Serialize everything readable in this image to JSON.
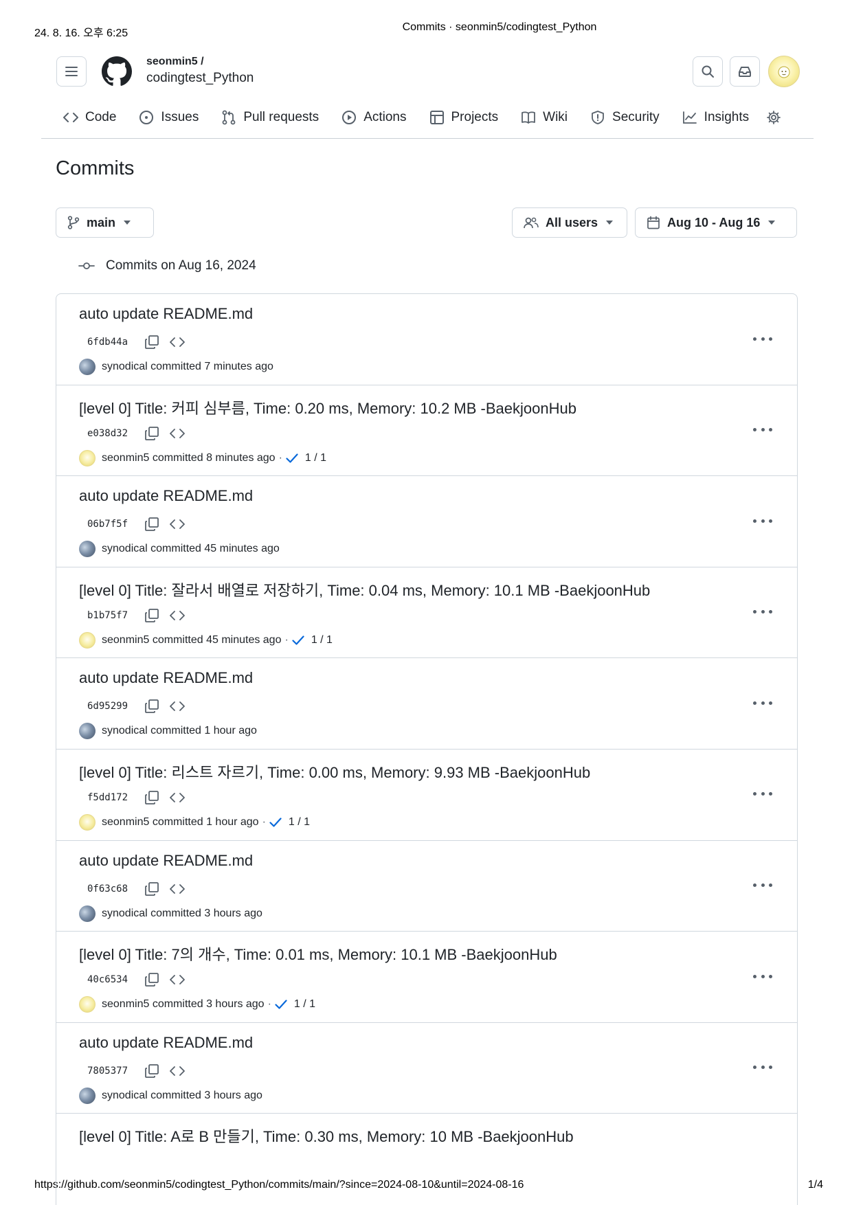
{
  "print": {
    "date": "24. 8. 16. 오후 6:25",
    "doc_title": "Commits · seonmin5/codingtest_Python",
    "url": "https://github.com/seonmin5/codingtest_Python/commits/main/?since=2024-08-10&until=2024-08-16",
    "page": "1/4"
  },
  "header": {
    "owner": "seonmin5 /",
    "repo": "codingtest_Python"
  },
  "tabs": [
    {
      "label": "Code",
      "icon": "code-icon"
    },
    {
      "label": "Issues",
      "icon": "issue-icon"
    },
    {
      "label": "Pull requests",
      "icon": "pull-request-icon"
    },
    {
      "label": "Actions",
      "icon": "play-icon"
    },
    {
      "label": "Projects",
      "icon": "table-icon"
    },
    {
      "label": "Wiki",
      "icon": "book-icon"
    },
    {
      "label": "Security",
      "icon": "shield-icon"
    },
    {
      "label": "Insights",
      "icon": "graph-icon"
    }
  ],
  "page_title": "Commits",
  "filters": {
    "branch": "main",
    "users": "All users",
    "date_range": "Aug 10 - Aug 16"
  },
  "group_heading": "Commits on Aug 16, 2024",
  "commits": [
    {
      "title": "auto update README.md",
      "sha": "6fdb44a",
      "author": "synodical",
      "time": "committed 7 minutes ago",
      "checks": ""
    },
    {
      "title": "[level 0] Title: 커피 심부름, Time: 0.20 ms, Memory: 10.2 MB -BaekjoonHub",
      "sha": "e038d32",
      "author": "seonmin5",
      "time": "committed 8 minutes ago",
      "checks": "1 / 1"
    },
    {
      "title": "auto update README.md",
      "sha": "06b7f5f",
      "author": "synodical",
      "time": "committed 45 minutes ago",
      "checks": ""
    },
    {
      "title": "[level 0] Title: 잘라서 배열로 저장하기, Time: 0.04 ms, Memory: 10.1 MB -BaekjoonHub",
      "sha": "b1b75f7",
      "author": "seonmin5",
      "time": "committed 45 minutes ago",
      "checks": "1 / 1"
    },
    {
      "title": "auto update README.md",
      "sha": "6d95299",
      "author": "synodical",
      "time": "committed 1 hour ago",
      "checks": ""
    },
    {
      "title": "[level 0] Title: 리스트 자르기, Time: 0.00 ms, Memory: 9.93 MB -BaekjoonHub",
      "sha": "f5dd172",
      "author": "seonmin5",
      "time": "committed 1 hour ago",
      "checks": "1 / 1"
    },
    {
      "title": "auto update README.md",
      "sha": "0f63c68",
      "author": "synodical",
      "time": "committed 3 hours ago",
      "checks": ""
    },
    {
      "title": "[level 0] Title: 7의 개수, Time: 0.01 ms, Memory: 10.1 MB -BaekjoonHub",
      "sha": "40c6534",
      "author": "seonmin5",
      "time": "committed 3 hours ago",
      "checks": "1 / 1"
    },
    {
      "title": "auto update README.md",
      "sha": "7805377",
      "author": "synodical",
      "time": "committed 3 hours ago",
      "checks": ""
    },
    {
      "title": "[level 0] Title: A로 B 만들기, Time: 0.30 ms, Memory: 10 MB -BaekjoonHub",
      "sha": "",
      "author": "",
      "time": "",
      "checks": ""
    }
  ]
}
